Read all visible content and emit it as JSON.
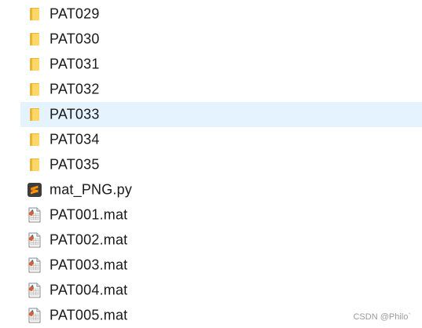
{
  "files": [
    {
      "name": "PAT029",
      "type": "folder",
      "icon": "folder-icon",
      "selected": false
    },
    {
      "name": "PAT030",
      "type": "folder",
      "icon": "folder-icon",
      "selected": false
    },
    {
      "name": "PAT031",
      "type": "folder",
      "icon": "folder-icon",
      "selected": false
    },
    {
      "name": "PAT032",
      "type": "folder",
      "icon": "folder-icon",
      "selected": false
    },
    {
      "name": "PAT033",
      "type": "folder",
      "icon": "folder-icon",
      "selected": true
    },
    {
      "name": "PAT034",
      "type": "folder",
      "icon": "folder-icon",
      "selected": false
    },
    {
      "name": "PAT035",
      "type": "folder",
      "icon": "folder-icon",
      "selected": false
    },
    {
      "name": "mat_PNG.py",
      "type": "python",
      "icon": "sublime-text-icon",
      "selected": false
    },
    {
      "name": "PAT001.mat",
      "type": "mat",
      "icon": "matlab-file-icon",
      "selected": false
    },
    {
      "name": "PAT002.mat",
      "type": "mat",
      "icon": "matlab-file-icon",
      "selected": false
    },
    {
      "name": "PAT003.mat",
      "type": "mat",
      "icon": "matlab-file-icon",
      "selected": false
    },
    {
      "name": "PAT004.mat",
      "type": "mat",
      "icon": "matlab-file-icon",
      "selected": false
    },
    {
      "name": "PAT005.mat",
      "type": "mat",
      "icon": "matlab-file-icon",
      "selected": false
    }
  ],
  "colors": {
    "selected_row_bg": "#e5f3ff",
    "folder_yellow": "#ffd766",
    "folder_dark": "#e8b43a",
    "sublime_bg": "#3d3d3d",
    "sublime_orange": "#ff9800"
  },
  "watermark": "CSDN @Philo`"
}
